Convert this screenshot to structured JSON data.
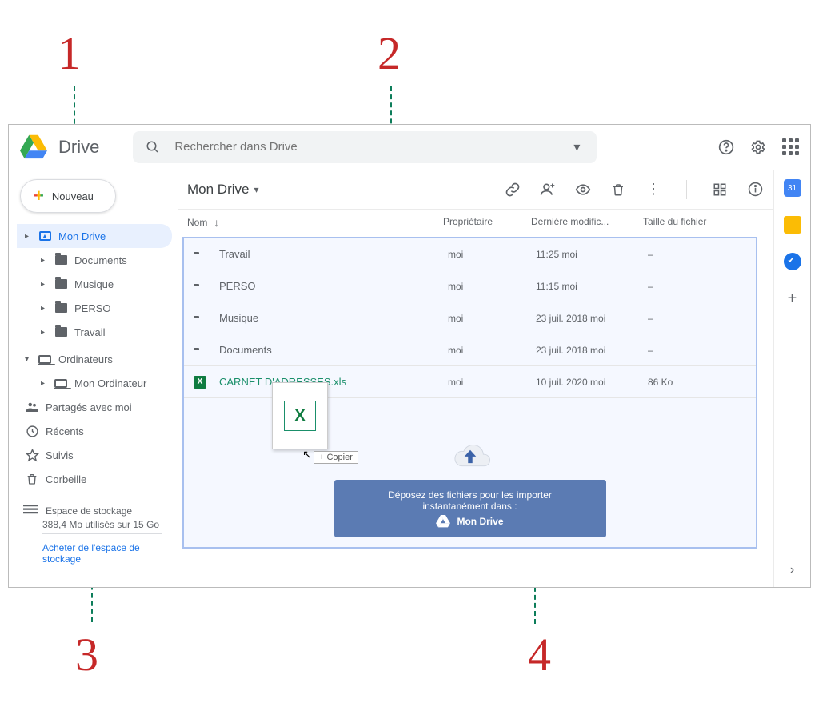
{
  "callouts": {
    "c1": "1",
    "c2": "2",
    "c3": "3",
    "c4": "4"
  },
  "app": {
    "name": "Drive"
  },
  "search": {
    "placeholder": "Rechercher dans Drive"
  },
  "newButton": {
    "label": "Nouveau"
  },
  "sidebar": {
    "items": [
      {
        "label": "Mon Drive"
      },
      {
        "label": "Documents"
      },
      {
        "label": "Musique"
      },
      {
        "label": "PERSO"
      },
      {
        "label": "Travail"
      }
    ],
    "computers": {
      "label": "Ordinateurs",
      "child": "Mon Ordinateur"
    },
    "shared": "Partagés avec moi",
    "recent": "Récents",
    "starred": "Suivis",
    "trash": "Corbeille",
    "storageTitle": "Espace de stockage",
    "storageUsed": "388,4 Mo utilisés sur 15 Go",
    "buyStorage": "Acheter de l'espace de stockage"
  },
  "breadcrumb": {
    "label": "Mon Drive"
  },
  "columns": {
    "name": "Nom",
    "owner": "Propriétaire",
    "modified": "Dernière modific...",
    "size": "Taille du fichier"
  },
  "rows": [
    {
      "type": "folder",
      "name": "Travail",
      "owner": "moi",
      "modified": "11:25 moi",
      "size": "–"
    },
    {
      "type": "folder",
      "name": "PERSO",
      "owner": "moi",
      "modified": "11:15 moi",
      "size": "–"
    },
    {
      "type": "folder",
      "name": "Musique",
      "owner": "moi",
      "modified": "23 juil. 2018 moi",
      "size": "–"
    },
    {
      "type": "folder",
      "name": "Documents",
      "owner": "moi",
      "modified": "23 juil. 2018 moi",
      "size": "–"
    },
    {
      "type": "file",
      "name": "CARNET D'ADRESSES.xls",
      "owner": "moi",
      "modified": "10 juil. 2020 moi",
      "size": "86 Ko"
    }
  ],
  "dragTooltip": "+ Copier",
  "dropzone": {
    "line1": "Déposez des fichiers pour les importer instantanément dans :",
    "line2": "Mon Drive"
  },
  "sidepanel": {
    "calendarDay": "31"
  }
}
